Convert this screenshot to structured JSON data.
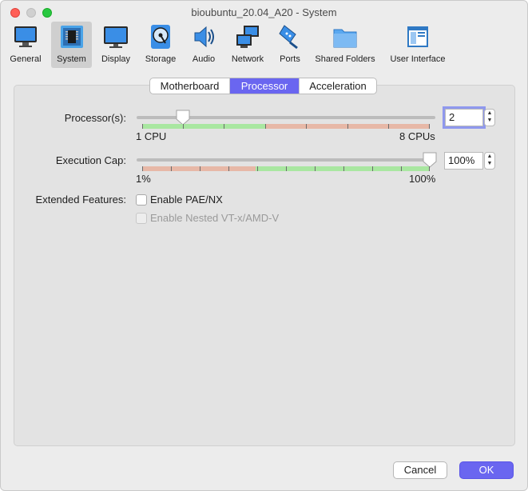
{
  "window": {
    "title": "bioubuntu_20.04_A20 - System"
  },
  "toolbar": {
    "items": [
      {
        "label": "General",
        "icon": "monitor-gear-icon"
      },
      {
        "label": "System",
        "icon": "chip-icon"
      },
      {
        "label": "Display",
        "icon": "display-icon"
      },
      {
        "label": "Storage",
        "icon": "disk-icon"
      },
      {
        "label": "Audio",
        "icon": "speaker-icon"
      },
      {
        "label": "Network",
        "icon": "network-icon"
      },
      {
        "label": "Ports",
        "icon": "plug-icon"
      },
      {
        "label": "Shared Folders",
        "icon": "folder-icon"
      },
      {
        "label": "User Interface",
        "icon": "window-icon"
      }
    ],
    "selected": "System"
  },
  "tabs": {
    "items": [
      "Motherboard",
      "Processor",
      "Acceleration"
    ],
    "selected": "Processor"
  },
  "processor": {
    "label": "Processor(s):",
    "value": "2",
    "min_label": "1 CPU",
    "max_label": "8 CPUs",
    "min": 1,
    "max": 8,
    "current": 2
  },
  "execution_cap": {
    "label": "Execution Cap:",
    "value": "100%",
    "min_label": "1%",
    "max_label": "100%",
    "min": 1,
    "max": 100,
    "current": 100
  },
  "extended_features": {
    "label": "Extended Features:",
    "options": [
      {
        "label": "Enable PAE/NX",
        "checked": false,
        "enabled": true
      },
      {
        "label": "Enable Nested VT-x/AMD-V",
        "checked": false,
        "enabled": false
      }
    ]
  },
  "buttons": {
    "cancel": "Cancel",
    "ok": "OK"
  },
  "colors": {
    "accent": "#6a66f0",
    "scale_green": "#a9e7a1",
    "scale_red": "#e7b8a7"
  }
}
